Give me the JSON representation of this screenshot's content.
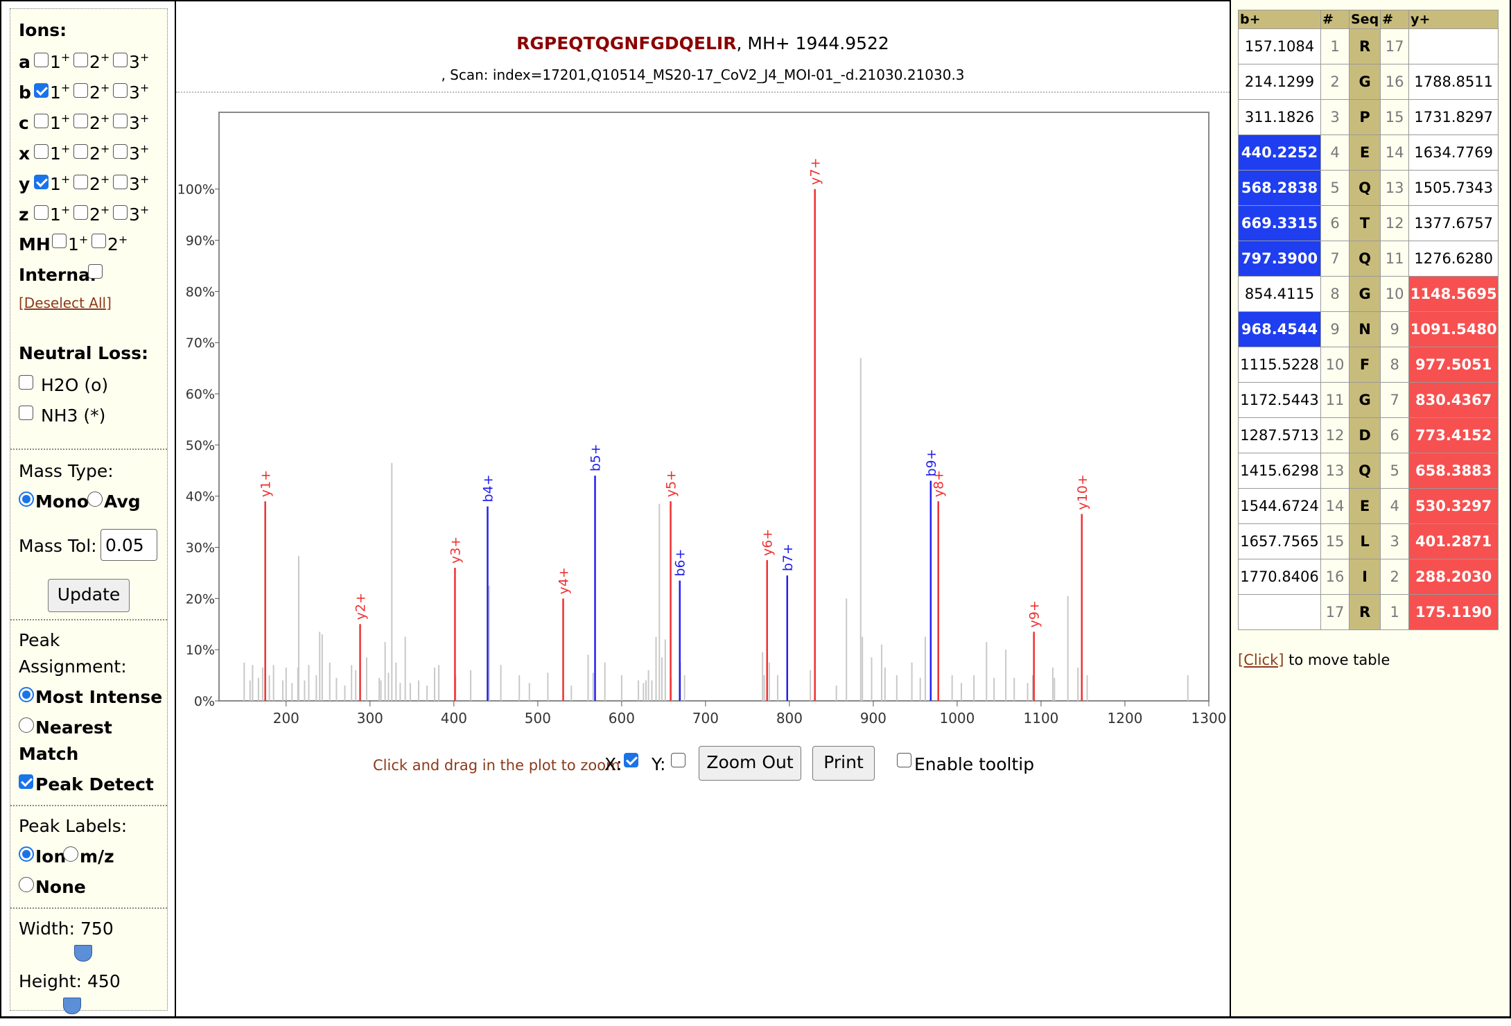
{
  "options": {
    "ions_heading": "Ions:",
    "ion_rows": [
      {
        "label": "a",
        "checked": [
          false,
          false,
          false
        ]
      },
      {
        "label": "b",
        "checked": [
          true,
          false,
          false
        ]
      },
      {
        "label": "c",
        "checked": [
          false,
          false,
          false
        ]
      },
      {
        "label": "x",
        "checked": [
          false,
          false,
          false
        ]
      },
      {
        "label": "y",
        "checked": [
          true,
          false,
          false
        ]
      },
      {
        "label": "z",
        "checked": [
          false,
          false,
          false
        ]
      }
    ],
    "charge_labels": [
      "1",
      "2",
      "3"
    ],
    "mh_label": "MH",
    "internal_label": "Internal",
    "deselect_all": "[Deselect All]",
    "neutral_loss_heading": "Neutral Loss:",
    "h2o_label": "H2O (o)",
    "nh3_label": "NH3 (*)",
    "mass_type_heading": "Mass Type:",
    "mono_label": "Mono",
    "avg_label": "Avg",
    "mass_tol_label": "Mass Tol:",
    "mass_tol_value": "0.05",
    "update_label": "Update",
    "peak_assignment_heading_1": "Peak",
    "peak_assignment_heading_2": "Assignment:",
    "most_intense_label": "Most Intense",
    "nearest_label_1": "Nearest",
    "nearest_label_2": "Match",
    "peak_detect_label": "Peak Detect",
    "peak_labels_heading": "Peak Labels:",
    "ion_label": "Ion",
    "mz_label": "m/z",
    "none_label": "None",
    "width_label": "Width: 750",
    "height_label": "Height: 450"
  },
  "header": {
    "sequence": "RGPEQTQGNFGDQELIR",
    "mh_text": ", MH+ 1944.9522",
    "scan_text": ", Scan: index=17201,Q10514_MS20-17_CoV2_J4_MOI-01_-d.21030.21030.3"
  },
  "controls": {
    "zoom_hint": "Click and drag in the plot to zoom",
    "x_label": "X:",
    "y_label": "Y:",
    "zoom_out": "Zoom Out",
    "print": "Print",
    "tooltip_label": "Enable tooltip"
  },
  "table": {
    "headers": [
      "b+",
      "#",
      "Seq",
      "#",
      "y+"
    ],
    "rows": [
      {
        "b": "157.1084",
        "n": "1",
        "aa": "R",
        "n2": "17",
        "y": "",
        "hb": false,
        "hy": false
      },
      {
        "b": "214.1299",
        "n": "2",
        "aa": "G",
        "n2": "16",
        "y": "1788.8511",
        "hb": false,
        "hy": false
      },
      {
        "b": "311.1826",
        "n": "3",
        "aa": "P",
        "n2": "15",
        "y": "1731.8297",
        "hb": false,
        "hy": false
      },
      {
        "b": "440.2252",
        "n": "4",
        "aa": "E",
        "n2": "14",
        "y": "1634.7769",
        "hb": true,
        "hy": false
      },
      {
        "b": "568.2838",
        "n": "5",
        "aa": "Q",
        "n2": "13",
        "y": "1505.7343",
        "hb": true,
        "hy": false
      },
      {
        "b": "669.3315",
        "n": "6",
        "aa": "T",
        "n2": "12",
        "y": "1377.6757",
        "hb": true,
        "hy": false
      },
      {
        "b": "797.3900",
        "n": "7",
        "aa": "Q",
        "n2": "11",
        "y": "1276.6280",
        "hb": true,
        "hy": false
      },
      {
        "b": "854.4115",
        "n": "8",
        "aa": "G",
        "n2": "10",
        "y": "1148.5695",
        "hb": false,
        "hy": true
      },
      {
        "b": "968.4544",
        "n": "9",
        "aa": "N",
        "n2": "9",
        "y": "1091.5480",
        "hb": true,
        "hy": true
      },
      {
        "b": "1115.5228",
        "n": "10",
        "aa": "F",
        "n2": "8",
        "y": "977.5051",
        "hb": false,
        "hy": true
      },
      {
        "b": "1172.5443",
        "n": "11",
        "aa": "G",
        "n2": "7",
        "y": "830.4367",
        "hb": false,
        "hy": true
      },
      {
        "b": "1287.5713",
        "n": "12",
        "aa": "D",
        "n2": "6",
        "y": "773.4152",
        "hb": false,
        "hy": true
      },
      {
        "b": "1415.6298",
        "n": "13",
        "aa": "Q",
        "n2": "5",
        "y": "658.3883",
        "hb": false,
        "hy": true
      },
      {
        "b": "1544.6724",
        "n": "14",
        "aa": "E",
        "n2": "4",
        "y": "530.3297",
        "hb": false,
        "hy": true
      },
      {
        "b": "1657.7565",
        "n": "15",
        "aa": "L",
        "n2": "3",
        "y": "401.2871",
        "hb": false,
        "hy": true
      },
      {
        "b": "1770.8406",
        "n": "16",
        "aa": "I",
        "n2": "2",
        "y": "288.2030",
        "hb": false,
        "hy": true
      },
      {
        "b": "",
        "n": "17",
        "aa": "R",
        "n2": "1",
        "y": "175.1190",
        "hb": false,
        "hy": true
      }
    ],
    "click_link": "[Click]",
    "click_text": " to move table"
  },
  "chart_data": {
    "type": "bar",
    "title": "",
    "xlabel": "",
    "ylabel": "",
    "xlim": [
      120,
      1300
    ],
    "ylim": [
      0,
      115
    ],
    "xticks": [
      200,
      300,
      400,
      500,
      600,
      700,
      800,
      900,
      1000,
      1100,
      1200,
      1300
    ],
    "yticks": [
      0,
      10,
      20,
      30,
      40,
      50,
      60,
      70,
      80,
      90,
      100
    ],
    "ytick_labels": [
      "0%",
      "10%",
      "20%",
      "30%",
      "40%",
      "50%",
      "60%",
      "70%",
      "80%",
      "90%",
      "100%"
    ],
    "colors": {
      "y": "#f03030",
      "b": "#2020f0",
      "unmatched": "#c8c8c8"
    },
    "matched_peaks": [
      {
        "label": "y1+",
        "mz": 175.1,
        "intensity": 39,
        "series": "y"
      },
      {
        "label": "y2+",
        "mz": 288.2,
        "intensity": 15,
        "series": "y"
      },
      {
        "label": "y3+",
        "mz": 401.3,
        "intensity": 26,
        "series": "y"
      },
      {
        "label": "b4+",
        "mz": 440.2,
        "intensity": 38,
        "series": "b"
      },
      {
        "label": "y4+",
        "mz": 530.3,
        "intensity": 20,
        "series": "y"
      },
      {
        "label": "b5+",
        "mz": 568.3,
        "intensity": 44,
        "series": "b"
      },
      {
        "label": "y5+",
        "mz": 658.4,
        "intensity": 39,
        "series": "y"
      },
      {
        "label": "b6+",
        "mz": 669.3,
        "intensity": 23.5,
        "series": "b"
      },
      {
        "label": "y6+",
        "mz": 773.4,
        "intensity": 27.5,
        "series": "y"
      },
      {
        "label": "b7+",
        "mz": 797.4,
        "intensity": 24.5,
        "series": "b"
      },
      {
        "label": "y7+",
        "mz": 830.4,
        "intensity": 100,
        "series": "y"
      },
      {
        "label": "b9+",
        "mz": 968.5,
        "intensity": 43,
        "series": "b"
      },
      {
        "label": "y8+",
        "mz": 977.5,
        "intensity": 39,
        "series": "y"
      },
      {
        "label": "y9+",
        "mz": 1091.5,
        "intensity": 13.5,
        "series": "y"
      },
      {
        "label": "y10+",
        "mz": 1148.6,
        "intensity": 36.5,
        "series": "y"
      }
    ],
    "unmatched_peaks": [
      [
        150,
        7.5
      ],
      [
        157,
        4
      ],
      [
        160,
        7
      ],
      [
        167,
        4.5
      ],
      [
        172,
        6.5
      ],
      [
        180,
        5
      ],
      [
        185,
        7
      ],
      [
        196,
        4
      ],
      [
        200,
        6.5
      ],
      [
        207,
        3.5
      ],
      [
        214,
        6.5
      ],
      [
        215,
        28.3
      ],
      [
        222,
        4
      ],
      [
        227,
        7
      ],
      [
        236,
        5
      ],
      [
        240,
        13.5
      ],
      [
        243,
        13
      ],
      [
        252,
        7.5
      ],
      [
        260,
        4.5
      ],
      [
        270,
        3
      ],
      [
        278,
        7
      ],
      [
        283,
        6
      ],
      [
        296,
        8.5
      ],
      [
        311,
        4.5
      ],
      [
        313,
        4
      ],
      [
        318,
        11.5
      ],
      [
        322,
        5.5
      ],
      [
        326,
        46.5
      ],
      [
        331,
        7.5
      ],
      [
        336,
        3.5
      ],
      [
        342,
        12.5
      ],
      [
        348,
        3.5
      ],
      [
        358,
        4
      ],
      [
        368,
        3
      ],
      [
        377,
        6.5
      ],
      [
        382,
        7
      ],
      [
        402,
        5
      ],
      [
        420,
        6
      ],
      [
        440,
        6
      ],
      [
        442,
        22.5
      ],
      [
        456,
        7
      ],
      [
        478,
        5
      ],
      [
        490,
        3.5
      ],
      [
        512,
        5.5
      ],
      [
        540,
        3
      ],
      [
        560,
        9
      ],
      [
        566,
        5.5
      ],
      [
        580,
        7.5
      ],
      [
        600,
        5
      ],
      [
        620,
        4
      ],
      [
        626,
        3.5
      ],
      [
        629,
        4
      ],
      [
        632,
        6
      ],
      [
        636,
        4
      ],
      [
        641,
        12.5
      ],
      [
        645,
        38.5
      ],
      [
        648,
        8.5
      ],
      [
        652,
        12
      ],
      [
        659,
        4.5
      ],
      [
        670,
        7.5
      ],
      [
        675,
        5
      ],
      [
        768,
        9.5
      ],
      [
        770,
        5
      ],
      [
        776,
        7.5
      ],
      [
        786,
        5
      ],
      [
        825,
        6
      ],
      [
        856,
        3
      ],
      [
        868,
        20
      ],
      [
        885,
        67
      ],
      [
        887,
        12.5
      ],
      [
        898,
        8.5
      ],
      [
        910,
        11
      ],
      [
        914,
        6.5
      ],
      [
        928,
        5
      ],
      [
        946,
        7.5
      ],
      [
        956,
        4.5
      ],
      [
        962,
        12.5
      ],
      [
        994,
        5
      ],
      [
        1005,
        3.5
      ],
      [
        1020,
        5
      ],
      [
        1035,
        11.5
      ],
      [
        1044,
        4.5
      ],
      [
        1058,
        10
      ],
      [
        1068,
        4.5
      ],
      [
        1084,
        3.5
      ],
      [
        1090,
        5
      ],
      [
        1114,
        6.5
      ],
      [
        1116,
        4.5
      ],
      [
        1132,
        20.5
      ],
      [
        1144,
        6.5
      ],
      [
        1155,
        5
      ],
      [
        1275,
        5
      ]
    ]
  }
}
